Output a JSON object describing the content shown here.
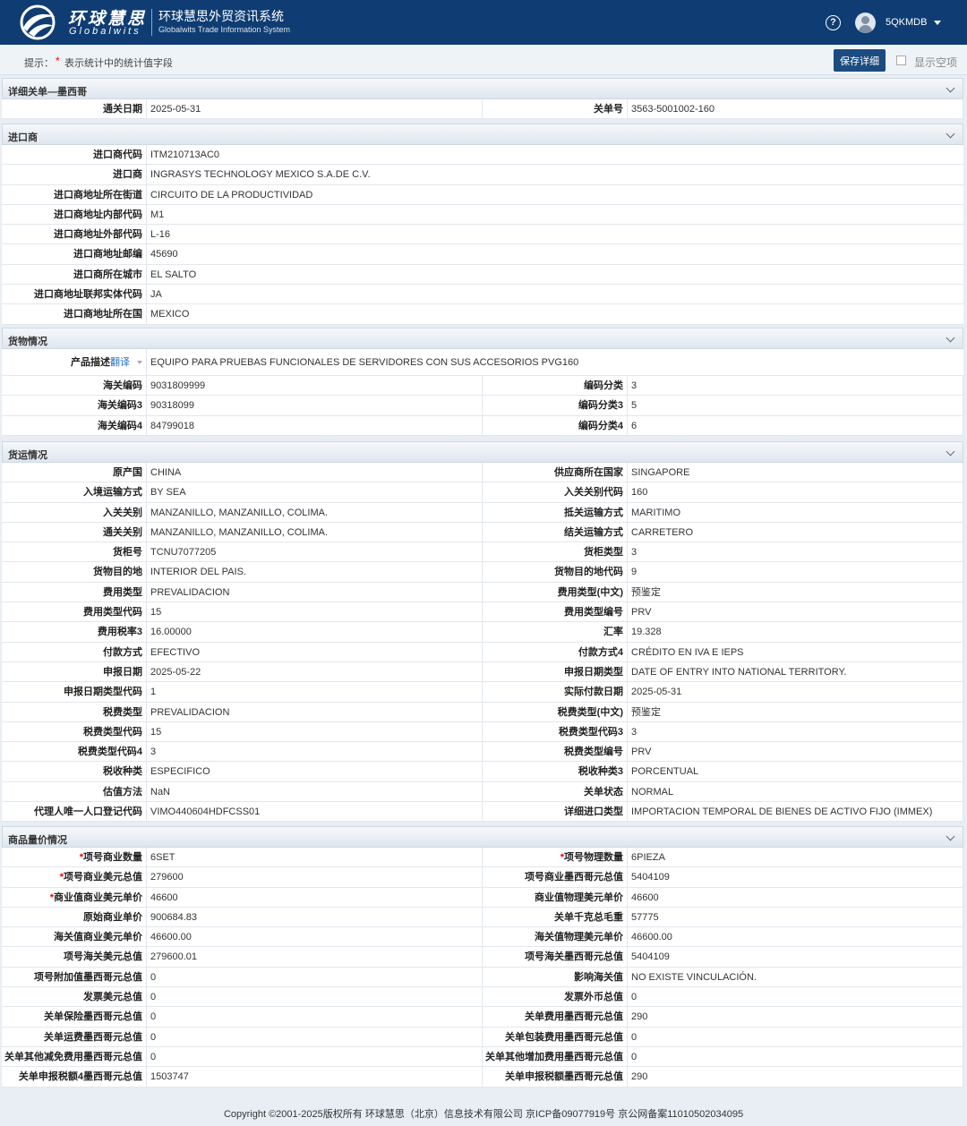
{
  "header": {
    "logo_cn": "环球慧思",
    "logo_en": "Globalwits",
    "system_cn": "环球慧思外贸资讯系统",
    "system_en": "Globalwits Trade Information System",
    "help": "?",
    "username": "5QKMDB"
  },
  "tipbar": {
    "label": "提示：",
    "star": "*",
    "text": "表示统计中的统计值字段",
    "save_label": "保存详细",
    "show_empty_label": "显示空项"
  },
  "sections": [
    {
      "title": "详细关单—墨西哥",
      "rows": [
        [
          {
            "label": "通关日期",
            "value": "2025-05-31"
          },
          {
            "label": "关单号",
            "value": "3563-5001002-160"
          }
        ]
      ]
    },
    {
      "title": "进口商",
      "rows": [
        [
          {
            "label": "进口商代码",
            "value": "ITM210713AC0"
          }
        ],
        [
          {
            "label": "进口商",
            "value": "INGRASYS TECHNOLOGY MEXICO S.A.DE C.V."
          }
        ],
        [
          {
            "label": "进口商地址所在街道",
            "value": "CIRCUITO DE LA PRODUCTIVIDAD"
          }
        ],
        [
          {
            "label": "进口商地址内部代码",
            "value": "M1"
          }
        ],
        [
          {
            "label": "进口商地址外部代码",
            "value": "L-16"
          }
        ],
        [
          {
            "label": "进口商地址邮编",
            "value": "45690"
          }
        ],
        [
          {
            "label": "进口商所在城市",
            "value": "EL SALTO"
          }
        ],
        [
          {
            "label": "进口商地址联邦实体代码",
            "value": "JA"
          }
        ],
        [
          {
            "label": "进口商地址所在国",
            "value": "MEXICO"
          }
        ]
      ]
    },
    {
      "title": "货物情况",
      "rows": [
        [
          {
            "label": "产品描述",
            "translate": "翻译",
            "value": "EQUIPO PARA PRUEBAS FUNCIONALES DE SERVIDORES CON SUS ACCESORIOS PVG160"
          }
        ],
        [
          {
            "label": "海关编码",
            "value": "9031809999"
          },
          {
            "label": "编码分类",
            "value": "3"
          }
        ],
        [
          {
            "label": "海关编码3",
            "value": "90318099"
          },
          {
            "label": "编码分类3",
            "value": "5"
          }
        ],
        [
          {
            "label": "海关编码4",
            "value": "84799018"
          },
          {
            "label": "编码分类4",
            "value": "6"
          }
        ]
      ]
    },
    {
      "title": "货运情况",
      "rows": [
        [
          {
            "label": "原产国",
            "value": "CHINA"
          },
          {
            "label": "供应商所在国家",
            "value": "SINGAPORE"
          }
        ],
        [
          {
            "label": "入境运输方式",
            "value": "BY SEA"
          },
          {
            "label": "入关关别代码",
            "value": "160"
          }
        ],
        [
          {
            "label": "入关关别",
            "value": "MANZANILLO, MANZANILLO, COLIMA."
          },
          {
            "label": "抵关运输方式",
            "value": "MARITIMO"
          }
        ],
        [
          {
            "label": "通关关别",
            "value": "MANZANILLO, MANZANILLO, COLIMA."
          },
          {
            "label": "结关运输方式",
            "value": "CARRETERO"
          }
        ],
        [
          {
            "label": "货柜号",
            "value": "TCNU7077205"
          },
          {
            "label": "货柜类型",
            "value": "3"
          }
        ],
        [
          {
            "label": "货物目的地",
            "value": "INTERIOR DEL PAIS."
          },
          {
            "label": "货物目的地代码",
            "value": "9"
          }
        ],
        [
          {
            "label": "费用类型",
            "value": "PREVALIDACION"
          },
          {
            "label": "费用类型(中文)",
            "value": "预鉴定"
          }
        ],
        [
          {
            "label": "费用类型代码",
            "value": "15"
          },
          {
            "label": "费用类型编号",
            "value": "PRV"
          }
        ],
        [
          {
            "label": "费用税率3",
            "value": "16.00000"
          },
          {
            "label": "汇率",
            "value": "19.328"
          }
        ],
        [
          {
            "label": "付款方式",
            "value": "EFECTIVO"
          },
          {
            "label": "付款方式4",
            "value": "CRÉDITO EN IVA E IEPS"
          }
        ],
        [
          {
            "label": "申报日期",
            "value": "2025-05-22"
          },
          {
            "label": "申报日期类型",
            "value": "DATE OF ENTRY INTO NATIONAL TERRITORY."
          }
        ],
        [
          {
            "label": "申报日期类型代码",
            "value": "1"
          },
          {
            "label": "实际付款日期",
            "value": "2025-05-31"
          }
        ],
        [
          {
            "label": "税费类型",
            "value": "PREVALIDACION"
          },
          {
            "label": "税费类型(中文)",
            "value": "预鉴定"
          }
        ],
        [
          {
            "label": "税费类型代码",
            "value": "15"
          },
          {
            "label": "税费类型代码3",
            "value": "3"
          }
        ],
        [
          {
            "label": "税费类型代码4",
            "value": "3"
          },
          {
            "label": "税费类型编号",
            "value": "PRV"
          }
        ],
        [
          {
            "label": "税收种类",
            "value": "ESPECIFICO"
          },
          {
            "label": "税收种类3",
            "value": "PORCENTUAL"
          }
        ],
        [
          {
            "label": "估值方法",
            "value": "NaN"
          },
          {
            "label": "关单状态",
            "value": "NORMAL"
          }
        ],
        [
          {
            "label": "代理人唯一人口登记代码",
            "value": "VIMO440604HDFCSS01"
          },
          {
            "label": "详细进口类型",
            "value": "IMPORTACION TEMPORAL DE BIENES DE ACTIVO FIJO (IMMEX)"
          }
        ]
      ]
    },
    {
      "title": "商品量价情况",
      "rows": [
        [
          {
            "label": "项号商业数量",
            "star": "*",
            "value": "6SET"
          },
          {
            "label": "项号物理数量",
            "star": "*",
            "value": "6PIEZA"
          }
        ],
        [
          {
            "label": "项号商业美元总值",
            "star": "*",
            "value": "279600"
          },
          {
            "label": "项号商业墨西哥元总值",
            "value": "5404109"
          }
        ],
        [
          {
            "label": "商业值商业美元单价",
            "star": "*",
            "value": "46600"
          },
          {
            "label": "商业值物理美元单价",
            "value": "46600"
          }
        ],
        [
          {
            "label": "原始商业单价",
            "value": "900684.83"
          },
          {
            "label": "关单千克总毛重",
            "value": "57775"
          }
        ],
        [
          {
            "label": "海关值商业美元单价",
            "value": "46600.00"
          },
          {
            "label": "海关值物理美元单价",
            "value": "46600.00"
          }
        ],
        [
          {
            "label": "项号海关美元总值",
            "value": "279600.01"
          },
          {
            "label": "项号海关墨西哥元总值",
            "value": "5404109"
          }
        ],
        [
          {
            "label": "项号附加值墨西哥元总值",
            "value": "0"
          },
          {
            "label": "影响海关值",
            "value": "NO EXISTE VINCULACIÓN."
          }
        ],
        [
          {
            "label": "发票美元总值",
            "value": "0"
          },
          {
            "label": "发票外币总值",
            "value": "0"
          }
        ],
        [
          {
            "label": "关单保险墨西哥元总值",
            "value": "0"
          },
          {
            "label": "关单费用墨西哥元总值",
            "value": "290"
          }
        ],
        [
          {
            "label": "关单运费墨西哥元总值",
            "value": "0"
          },
          {
            "label": "关单包装费用墨西哥元总值",
            "value": "0"
          }
        ],
        [
          {
            "label": "关单其他减免费用墨西哥元总值",
            "value": "0"
          },
          {
            "label": "关单其他增加费用墨西哥元总值",
            "value": "0"
          }
        ],
        [
          {
            "label": "关单申报税额4墨西哥元总值",
            "value": "1503747"
          },
          {
            "label": "关单申报税额墨西哥元总值",
            "value": "290"
          }
        ]
      ]
    }
  ],
  "footer": "Copyright ©2001-2025版权所有 环球慧思（北京）信息技术有限公司 京ICP备09077919号 京公网备案11010502034095"
}
